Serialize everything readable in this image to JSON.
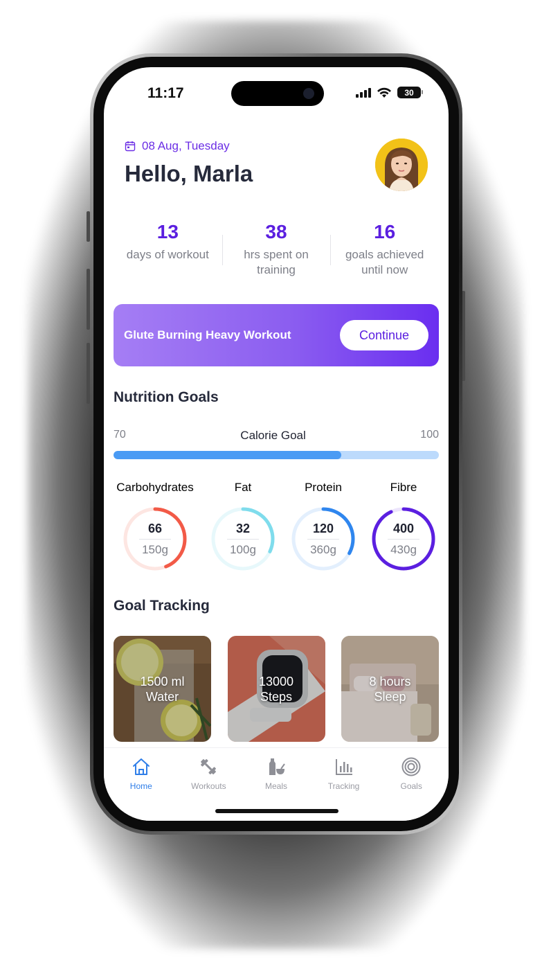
{
  "status_bar": {
    "time": "11:17",
    "battery": "30"
  },
  "header": {
    "date": "08 Aug, Tuesday",
    "greeting": "Hello, Marla"
  },
  "stats": [
    {
      "value": "13",
      "label": "days of workout"
    },
    {
      "value": "38",
      "label": "hrs spent on training"
    },
    {
      "value": "16",
      "label": "goals achieved until now"
    }
  ],
  "banner": {
    "title": "Glute Burning Heavy Workout",
    "button": "Continue"
  },
  "nutrition": {
    "title": "Nutrition Goals",
    "calorie": {
      "min": "70",
      "label": "Calorie Goal",
      "max": "100",
      "progress_fraction": 0.7
    },
    "macros": [
      {
        "name": "Carbohydrates",
        "value": "66",
        "total": "150g",
        "color": "#f25a47",
        "track": "#fde6e2",
        "fraction": 0.44
      },
      {
        "name": "Fat",
        "value": "32",
        "total": "100g",
        "color": "#7fdcec",
        "track": "#e7f8fb",
        "fraction": 0.32
      },
      {
        "name": "Protein",
        "value": "120",
        "total": "360g",
        "color": "#2f86ee",
        "track": "#e3effd",
        "fraction": 0.33
      },
      {
        "name": "Fibre",
        "value": "400",
        "total": "430g",
        "color": "#5b1fe0",
        "track": "#ece4fc",
        "fraction": 0.93
      }
    ]
  },
  "goal_tracking": {
    "title": "Goal Tracking",
    "cards": [
      {
        "line1": "1500 ml",
        "line2": "Water"
      },
      {
        "line1": "13000",
        "line2": "Steps"
      },
      {
        "line1": "8 hours",
        "line2": "Sleep"
      }
    ]
  },
  "tabs": [
    {
      "label": "Home",
      "icon": "home-icon"
    },
    {
      "label": "Workouts",
      "icon": "dumbbell-icon"
    },
    {
      "label": "Meals",
      "icon": "meals-icon"
    },
    {
      "label": "Tracking",
      "icon": "chart-icon"
    },
    {
      "label": "Goals",
      "icon": "target-icon"
    }
  ]
}
